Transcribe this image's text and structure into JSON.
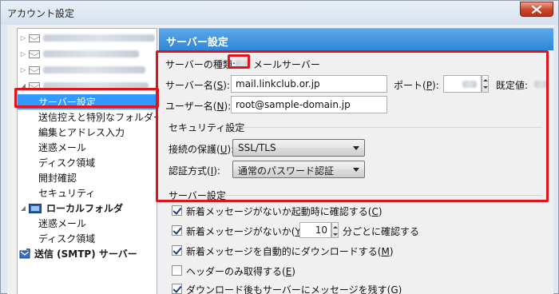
{
  "window": {
    "title": "アカウント設定",
    "close_icon": "close-x-icon"
  },
  "sidebar": {
    "accounts": [
      {
        "label": "",
        "expanded": false
      },
      {
        "label": "",
        "expanded": false
      },
      {
        "label": "",
        "expanded": false
      },
      {
        "label": "",
        "expanded": true
      }
    ],
    "account_subitems": [
      {
        "label": "サーバー設定",
        "selected": true
      },
      {
        "label": "送信控えと特別なフォルダー",
        "selected": false
      },
      {
        "label": "編集とアドレス入力",
        "selected": false
      },
      {
        "label": "迷惑メール",
        "selected": false
      },
      {
        "label": "ディスク領域",
        "selected": false
      },
      {
        "label": "開封確認",
        "selected": false
      },
      {
        "label": "セキュリティ",
        "selected": false
      }
    ],
    "local_folders": {
      "label": "ローカルフォルダ",
      "items": [
        "迷惑メール",
        "ディスク領域"
      ]
    },
    "smtp": {
      "label": "送信 (SMTP) サーバー"
    }
  },
  "main": {
    "banner_title": "サーバー設定",
    "server_type_label": "サーバーの種類:",
    "server_type_suffix": "メールサーバー",
    "server_name_label_pre": "サーバー名(",
    "server_name_label_key": "S",
    "server_name_label_post": "):",
    "server_name_value": "mail.linkclub.or.jp",
    "port_label_pre": "ポート(",
    "port_label_key": "P",
    "port_label_post": "):",
    "default_label": "既定値:",
    "user_name_label_pre": "ユーザー名(",
    "user_name_label_key": "N",
    "user_name_label_post": "):",
    "user_name_value": "root@sample-domain.jp",
    "security_heading": "セキュリティ設定",
    "conn_security_label_pre": "接続の保護(",
    "conn_security_label_key": "U",
    "conn_security_label_post": "):",
    "conn_security_value": "SSL/TLS",
    "auth_label_pre": "認証方式(",
    "auth_label_key": "I",
    "auth_label_post": "):",
    "auth_value": "通常のパスワード認証",
    "server_settings_heading": "サーバー設定",
    "options": [
      {
        "pre": "新着メッセージがないか起動時に確認する(",
        "key": "C",
        "post": ")",
        "checked": true
      },
      {
        "pre": "新着メッセージがないか(",
        "key": "Y",
        "post": ")",
        "checked": true,
        "interval_value": "10",
        "interval_suffix": "分ごとに確認する"
      },
      {
        "pre": "新着メッセージを自動的にダウンロードする(",
        "key": "M",
        "post": ")",
        "checked": true
      },
      {
        "pre": "ヘッダーのみ取得する(",
        "key": "E",
        "post": ")",
        "checked": false
      },
      {
        "pre": "ダウンロード後もサーバーにメッセージを残す(",
        "key": "G",
        "post": ")",
        "checked": true
      }
    ]
  },
  "colors": {
    "banner": "#3a8fdc",
    "highlight_border": "#e0141e",
    "selection": "#3399ff"
  }
}
